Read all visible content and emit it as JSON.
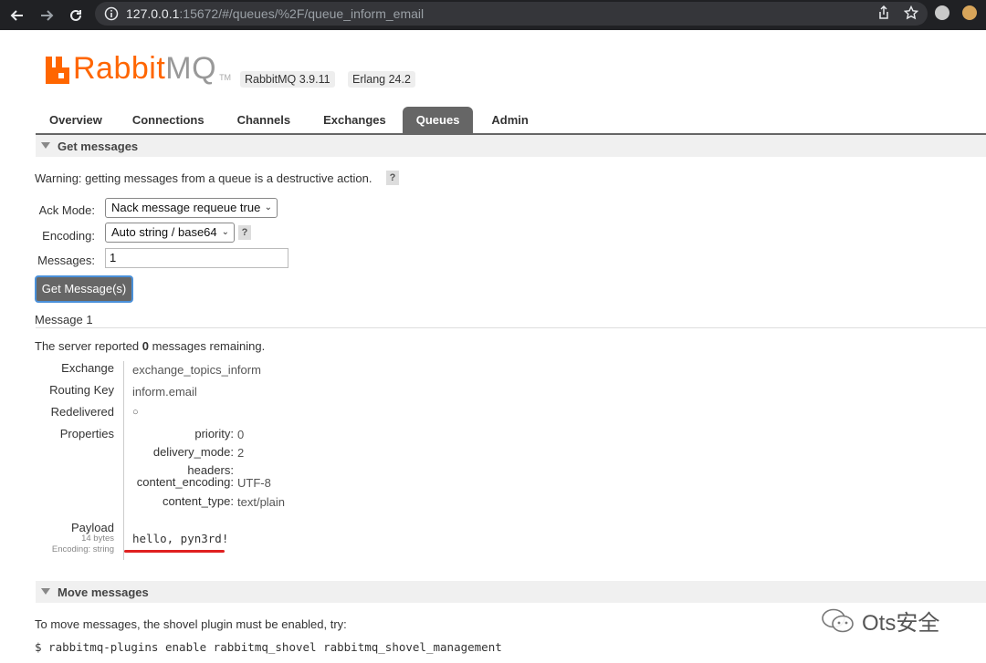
{
  "browser": {
    "url_host": "127.0.0.1",
    "url_path": ":15672/#/queues/%2F/queue_inform_email"
  },
  "header": {
    "logo_rabbit": "Rabbit",
    "logo_mq": "MQ",
    "logo_tm": "TM",
    "rabbitmq_version": "RabbitMQ 3.9.11",
    "erlang_version": "Erlang 24.2"
  },
  "tabs": [
    {
      "label": "Overview"
    },
    {
      "label": "Connections"
    },
    {
      "label": "Channels"
    },
    {
      "label": "Exchanges"
    },
    {
      "label": "Queues"
    },
    {
      "label": "Admin"
    }
  ],
  "get_messages": {
    "title": "Get messages",
    "warning": "Warning: getting messages from a queue is a destructive action.",
    "help": "?",
    "ack_mode_label": "Ack Mode:",
    "ack_mode_value": "Nack message requeue true",
    "encoding_label": "Encoding:",
    "encoding_value": "Auto string / base64",
    "messages_label": "Messages:",
    "messages_value": "1",
    "button": "Get Message(s)"
  },
  "message": {
    "heading": "Message 1",
    "remaining_prefix": "The server reported ",
    "remaining_count": "0",
    "remaining_suffix": " messages remaining.",
    "exchange_label": "Exchange",
    "exchange_value": "exchange_topics_inform",
    "routing_key_label": "Routing Key",
    "routing_key_value": "inform.email",
    "redelivered_label": "Redelivered",
    "redelivered_value": "○",
    "properties_label": "Properties",
    "properties": [
      {
        "key": "priority:",
        "value": "0"
      },
      {
        "key": "delivery_mode:",
        "value": "2"
      },
      {
        "key": "headers:",
        "value": ""
      },
      {
        "key": "content_encoding:",
        "value": "UTF-8"
      },
      {
        "key": "content_type:",
        "value": "text/plain"
      }
    ],
    "payload_label": "Payload",
    "payload_bytes": "14 bytes",
    "payload_encoding": "Encoding: string",
    "payload_value": "hello, pyn3rd!"
  },
  "move_messages": {
    "title": "Move messages",
    "instruction": "To move messages, the shovel plugin must be enabled, try:",
    "command": "$ rabbitmq-plugins enable rabbitmq_shovel rabbitmq_shovel_management"
  },
  "watermark": {
    "text": "Ots安全"
  },
  "colors": {
    "brand": "#ff6600",
    "tab_active": "#666666",
    "highlight": "#e02020"
  }
}
